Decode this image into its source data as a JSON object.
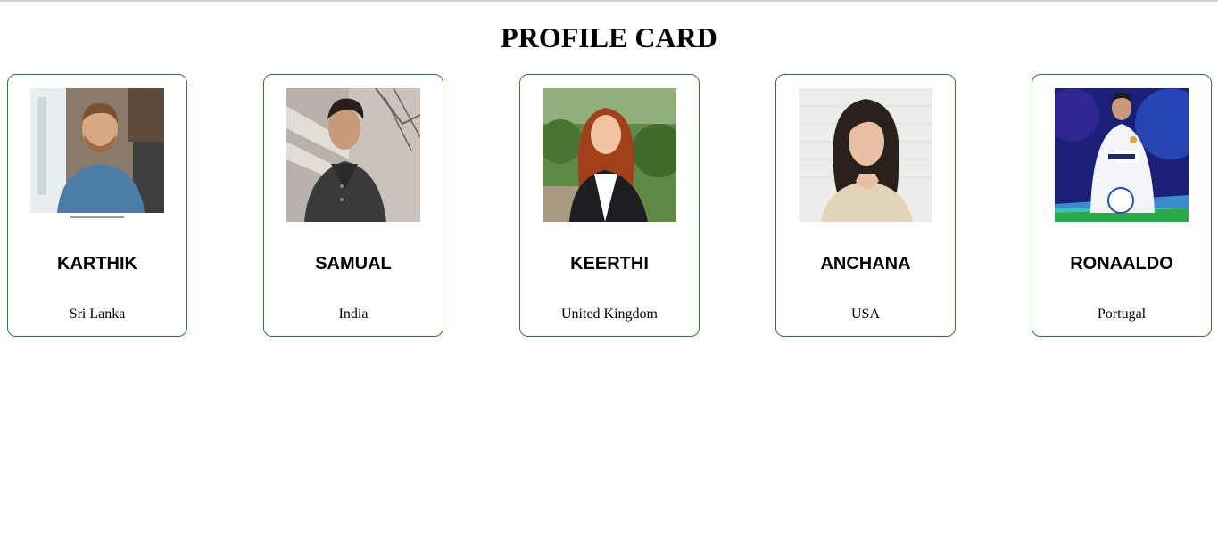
{
  "page": {
    "title": "PROFILE CARD"
  },
  "cards": [
    {
      "name": "KARTHIK",
      "country": "Sri Lanka",
      "photo_icon": "man-smiling-photo"
    },
    {
      "name": "SAMUAL",
      "country": "India",
      "photo_icon": "man-jacket-photo"
    },
    {
      "name": "KEERTHI",
      "country": "United Kingdom",
      "photo_icon": "woman-red-hair-photo"
    },
    {
      "name": "ANCHANA",
      "country": "USA",
      "photo_icon": "woman-dark-hair-photo"
    },
    {
      "name": "RONAALDO",
      "country": "Portugal",
      "photo_icon": "footballer-photo"
    }
  ],
  "colors": {
    "card_border": "#2e7d32",
    "text": "#000000",
    "background": "#ffffff"
  }
}
